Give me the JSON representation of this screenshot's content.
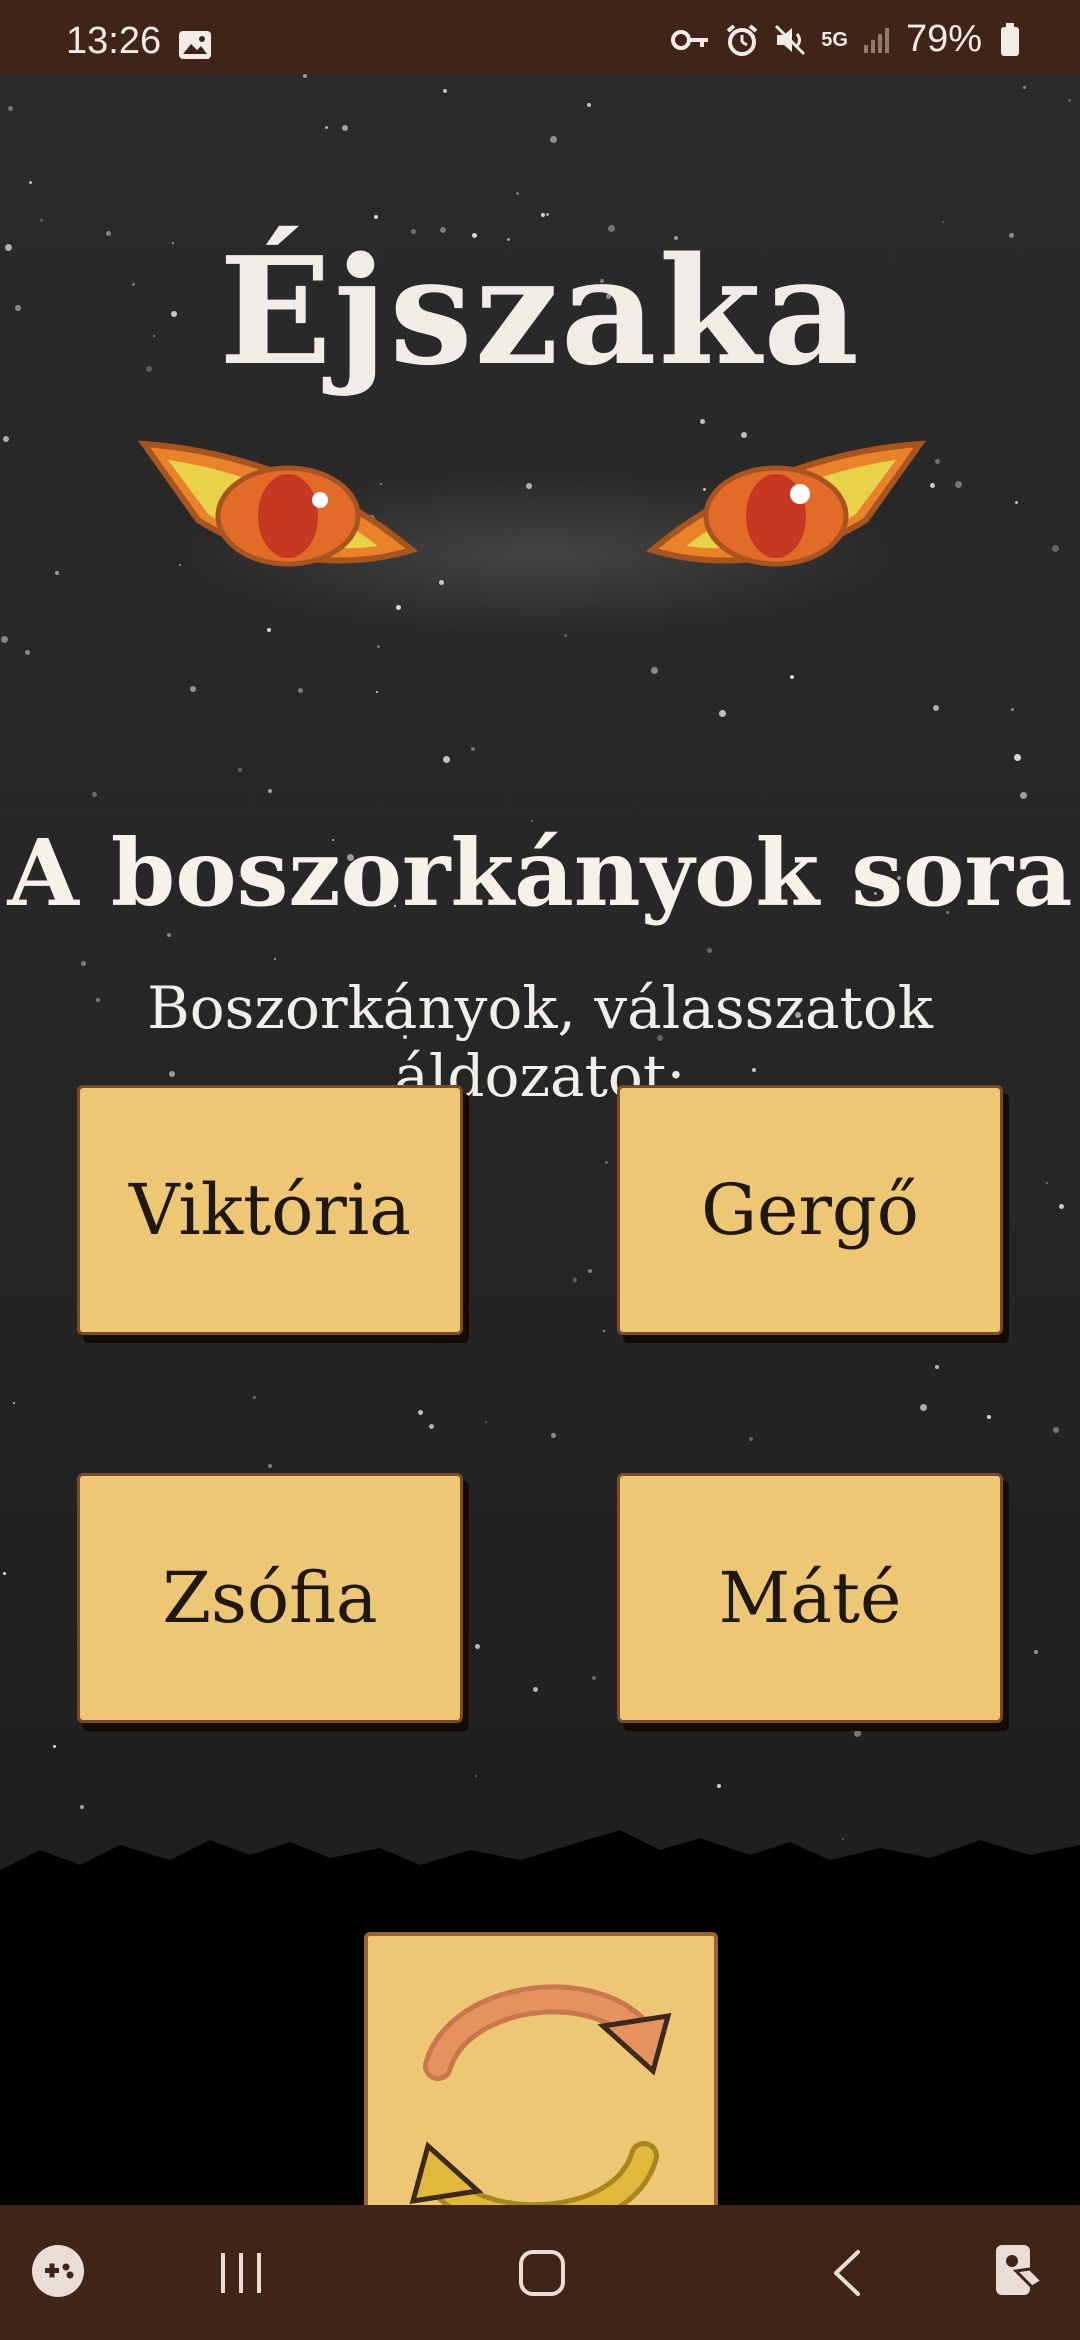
{
  "status_bar": {
    "time": "13:26",
    "network": "5G",
    "battery": "79%",
    "icons": [
      "image-icon",
      "key-icon",
      "alarm-icon",
      "mute-icon",
      "signal-icon",
      "battery-icon"
    ]
  },
  "screen": {
    "title": "Éjszaka",
    "subtitle": "A boszorkányok sora",
    "prompt": "Boszorkányok, válasszatok áldozatot:"
  },
  "choices": [
    {
      "label": "Viktória"
    },
    {
      "label": "Gergő"
    },
    {
      "label": "Zsófia"
    },
    {
      "label": "Máté"
    }
  ],
  "actions": {
    "refresh_icon": "refresh-icon"
  },
  "nav_bar": {
    "icons": [
      "game-icon",
      "recents-icon",
      "home-icon",
      "back-icon",
      "accessibility-icon"
    ]
  },
  "colors": {
    "bar_brown": "#3f2417",
    "button_fill": "#edc774",
    "button_border": "#7a4a2a",
    "eye_orange": "#e9822a",
    "eye_yellow": "#e9d24a"
  }
}
